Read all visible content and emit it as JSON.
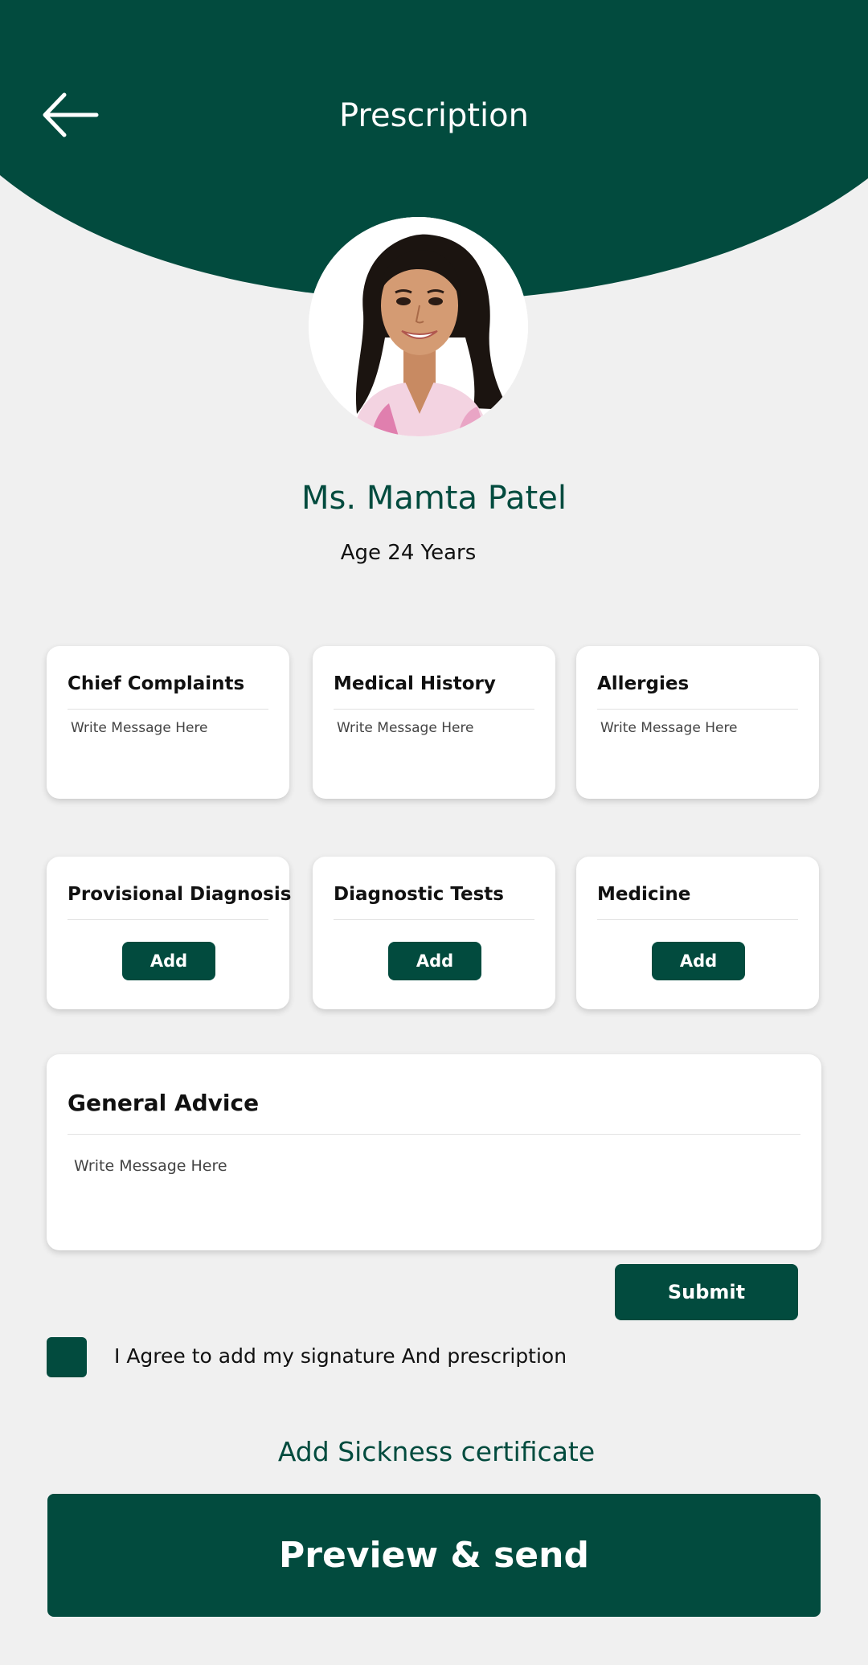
{
  "colors": {
    "primary": "#024b3e",
    "background": "#f0f0f0",
    "card": "#ffffff"
  },
  "header": {
    "title": "Prescription",
    "back_icon": "arrow-left-icon"
  },
  "patient": {
    "name": "Ms. Mamta Patel",
    "age": "Age 24 Years",
    "photo": "patient-photo"
  },
  "text_cards": [
    {
      "title": "Chief Complaints",
      "placeholder": "Write Message Here"
    },
    {
      "title": "Medical History",
      "placeholder": "Write Message Here"
    },
    {
      "title": "Allergies",
      "placeholder": "Write Message Here"
    }
  ],
  "add_cards": [
    {
      "title": "Provisional Diagnosis",
      "button": "Add"
    },
    {
      "title": "Diagnostic Tests",
      "button": "Add"
    },
    {
      "title": "Medicine",
      "button": "Add"
    }
  ],
  "advice": {
    "title": "General Advice",
    "placeholder": "Write Message Here"
  },
  "submit_label": "Submit",
  "agreement": {
    "checked": true,
    "label": "I Agree to add my signature And prescription"
  },
  "sickness_link": "Add Sickness certificate",
  "preview_button": "Preview & send"
}
